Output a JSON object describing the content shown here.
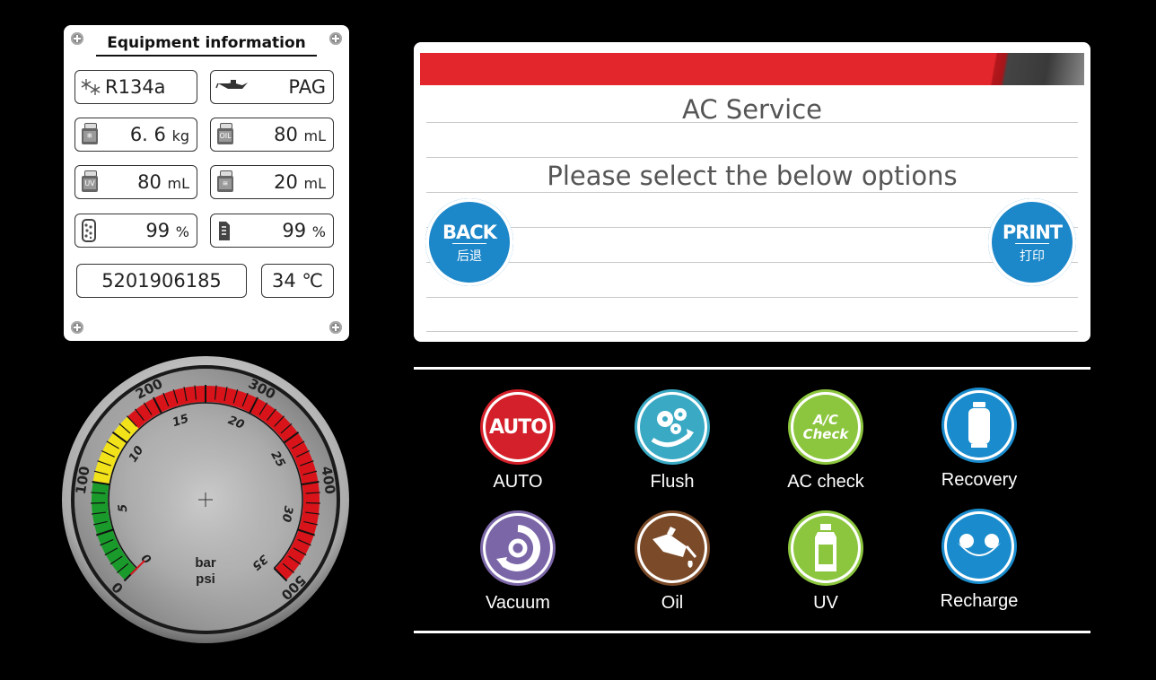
{
  "equipment": {
    "title": "Equipment information",
    "refrigerant": "R134a",
    "oil_type": "PAG",
    "refrigerant_weight": "6. 6",
    "refrigerant_weight_unit": "kg",
    "oil_volume": "80",
    "oil_volume_unit": "mL",
    "uv_volume": "80",
    "uv_volume_unit": "mL",
    "drain_volume": "20",
    "drain_volume_unit": "mL",
    "filter_percent": "99",
    "filter_percent_unit": "%",
    "pump_oil_percent": "99",
    "pump_oil_percent_unit": "%",
    "serial": "5201906185",
    "temperature": "34 ℃",
    "icons": {
      "oil_label": "OIL",
      "uv_label": "UV"
    }
  },
  "gauge": {
    "psi_labels": [
      "0",
      "100",
      "200",
      "300",
      "400",
      "500"
    ],
    "bar_labels": [
      "0",
      "5",
      "10",
      "15",
      "20",
      "25",
      "30",
      "35"
    ],
    "unit_bar": "bar",
    "unit_psi": "psi",
    "value_psi": 0,
    "zones": {
      "green": "#1a9a2a",
      "yellow": "#f2e21a",
      "red": "#d8141a"
    }
  },
  "service": {
    "title": "AC Service",
    "subtitle": "Please select the below options",
    "back": {
      "label": "BACK",
      "sub": "后退"
    },
    "print": {
      "label": "PRINT",
      "sub": "打印"
    },
    "bar_color": "#e2262b"
  },
  "functions": [
    {
      "label": "AUTO",
      "icon": "auto-icon",
      "icon_text": "AUTO",
      "color": "#d3202a"
    },
    {
      "label": "Flush",
      "icon": "flush-icon",
      "color": "#3aa9c4"
    },
    {
      "label": "AC check",
      "icon": "ac-check-icon",
      "icon_text": "A/C Check",
      "color": "#8cc63e"
    },
    {
      "label": "Recovery",
      "icon": "recovery-icon",
      "color": "#1a8ccd"
    },
    {
      "label": "Vacuum",
      "icon": "vacuum-icon",
      "color": "#7b66a8"
    },
    {
      "label": "Oil",
      "icon": "oil-icon",
      "color": "#7b4a28"
    },
    {
      "label": "UV",
      "icon": "uv-icon",
      "color": "#8cc63e"
    },
    {
      "label": "Recharge",
      "icon": "recharge-icon",
      "color": "#1a8ccd"
    }
  ]
}
